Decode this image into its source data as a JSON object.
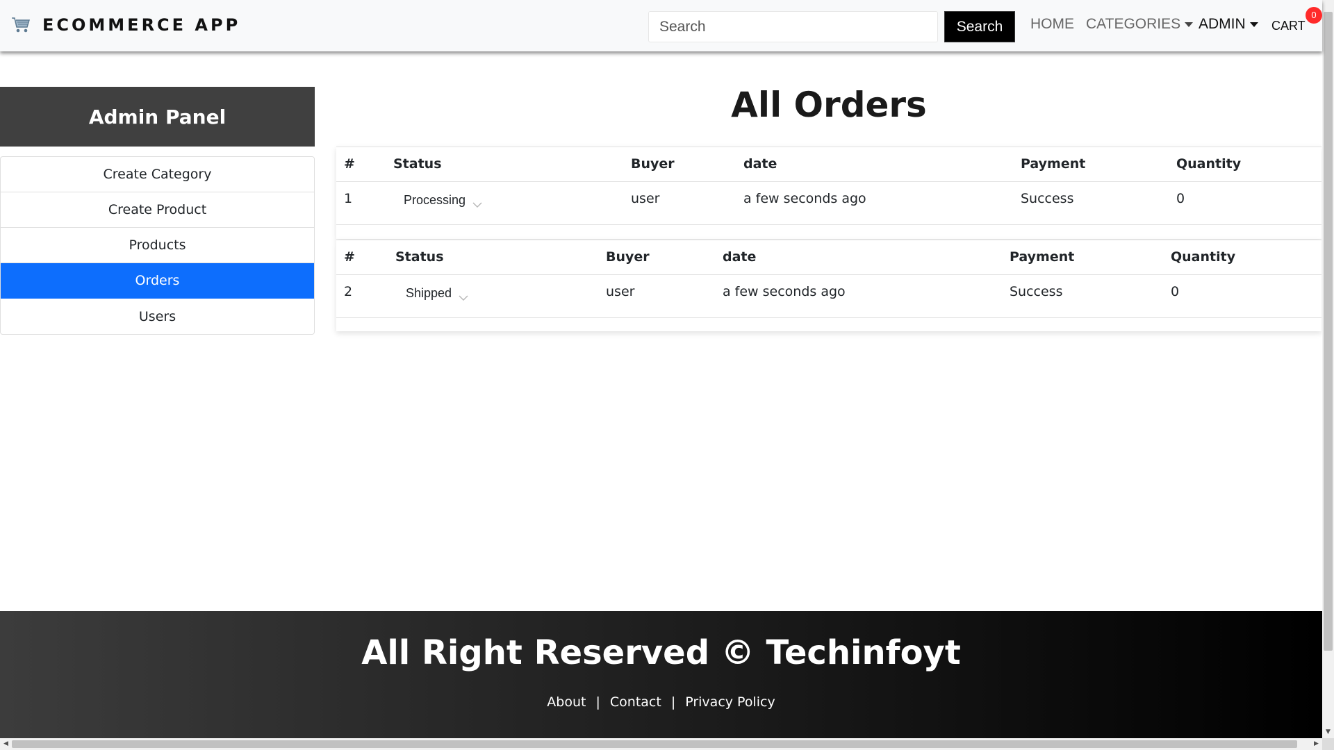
{
  "navbar": {
    "brand": "ECOMMERCE APP",
    "brand_icon": "shopping-cart-icon",
    "search_placeholder": "Search",
    "search_button": "Search",
    "links": {
      "home": "HOME",
      "categories": "CATEGORIES",
      "admin": "ADMIN",
      "cart": "CART"
    },
    "cart_count": "0"
  },
  "sidebar": {
    "title": "Admin Panel",
    "items": [
      {
        "label": "Create Category",
        "active": false
      },
      {
        "label": "Create Product",
        "active": false
      },
      {
        "label": "Products",
        "active": false
      },
      {
        "label": "Orders",
        "active": true
      },
      {
        "label": "Users",
        "active": false
      }
    ]
  },
  "main": {
    "title": "All Orders",
    "columns": {
      "num": "#",
      "status": "Status",
      "buyer": "Buyer",
      "date": "date",
      "payment": "Payment",
      "quantity": "Quantity"
    },
    "orders": [
      {
        "num": "1",
        "status": "Processing",
        "buyer": "user",
        "date": "a few seconds ago",
        "payment": "Success",
        "quantity": "0"
      },
      {
        "num": "2",
        "status": "Shipped",
        "buyer": "user",
        "date": "a few seconds ago",
        "payment": "Success",
        "quantity": "0"
      }
    ]
  },
  "footer": {
    "title": "All Right Reserved © Techinfoyt",
    "links": {
      "about": "About",
      "contact": "Contact",
      "privacy": "Privacy Policy"
    },
    "separator": "|"
  },
  "colors": {
    "accent": "#0d6efd",
    "navbar_bg": "#f8f9fa",
    "sidebar_header_bg": "#404040",
    "badge": "#ff2a2a"
  }
}
